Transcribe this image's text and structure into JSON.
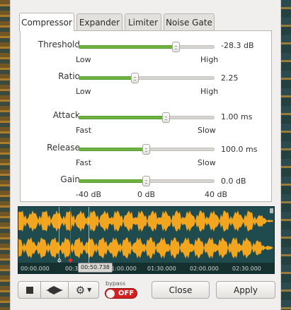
{
  "tabs": [
    {
      "label": "Compressor",
      "active": true
    },
    {
      "label": "Expander",
      "active": false
    },
    {
      "label": "Limiter",
      "active": false
    },
    {
      "label": "Noise Gate",
      "active": false
    }
  ],
  "sliders": {
    "threshold": {
      "label": "Threshold",
      "value": "-28.3 dB",
      "min_label": "Low",
      "max_label": "High",
      "level": 0.72
    },
    "ratio": {
      "label": "Ratio",
      "value": "2.25",
      "min_label": "Low",
      "max_label": "High",
      "level": 0.42
    },
    "attack": {
      "label": "Attack",
      "value": "1.00 ms",
      "min_label": "Fast",
      "max_label": "Slow",
      "level": 0.65
    },
    "release": {
      "label": "Release",
      "value": "100.0 ms",
      "min_label": "Fast",
      "max_label": "Slow",
      "level": 0.5
    },
    "gain": {
      "label": "Gain",
      "value": "0.0 dB",
      "min_label": "-40 dB",
      "mid_label": "0 dB",
      "max_label": "40 dB",
      "level": 0.5
    }
  },
  "waveform": {
    "colors": {
      "wave": "#f2a51f",
      "background": "#1f4a4e",
      "cursor": "#e53030"
    },
    "ruler": [
      "00:00.000",
      "00:30.000",
      "01:00.000",
      "01:30.000",
      "02:00.000",
      "02:30.000"
    ],
    "position_label": "00:50.738"
  },
  "toolbar": {
    "stop_icon": "stop-icon",
    "waveform_icon": "waveform-icon",
    "settings_icon": "gear-icon",
    "bypass_label": "bypass",
    "bypass_state": "OFF",
    "close_label": "Close",
    "apply_label": "Apply"
  },
  "colors": {
    "accent": "#6db33f",
    "toggle_off": "#d21f1f"
  }
}
